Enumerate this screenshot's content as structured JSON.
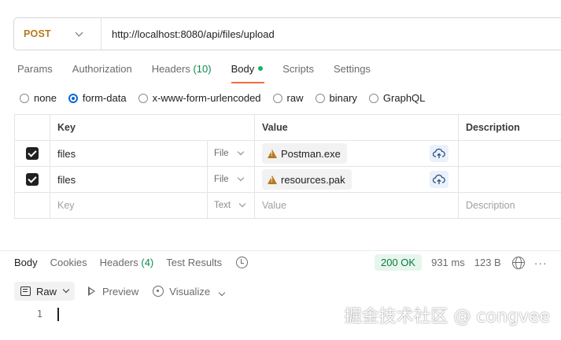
{
  "request": {
    "method": "POST",
    "url": "http://localhost:8080/api/files/upload",
    "method_color": "#b7791f"
  },
  "req_tabs": {
    "params": "Params",
    "authorization": "Authorization",
    "headers": "Headers",
    "headers_count": "(10)",
    "body": "Body",
    "scripts": "Scripts",
    "settings": "Settings"
  },
  "body_types": {
    "none": "none",
    "form_data": "form-data",
    "urlencoded": "x-www-form-urlencoded",
    "raw": "raw",
    "binary": "binary",
    "graphql": "GraphQL",
    "selected": "form-data"
  },
  "table": {
    "headers": {
      "key": "Key",
      "value": "Value",
      "description": "Description"
    },
    "rows": [
      {
        "checked": true,
        "key": "files",
        "type": "File",
        "value": "Postman.exe"
      },
      {
        "checked": true,
        "key": "files",
        "type": "File",
        "value": "resources.pak"
      }
    ],
    "new_row": {
      "key_placeholder": "Key",
      "type": "Text",
      "value_placeholder": "Value",
      "description_placeholder": "Description"
    }
  },
  "response": {
    "tabs": {
      "body": "Body",
      "cookies": "Cookies",
      "headers": "Headers",
      "headers_count": "(4)",
      "test_results": "Test Results"
    },
    "status": "200 OK",
    "time": "931 ms",
    "size": "123 B",
    "status_color": "#0b7a42"
  },
  "viewer": {
    "format": "Raw",
    "preview": "Preview",
    "visualize": "Visualize",
    "line_number": "1"
  },
  "watermark": "掘金技术社区 @ congvee",
  "accent_color": "#f26b3a"
}
